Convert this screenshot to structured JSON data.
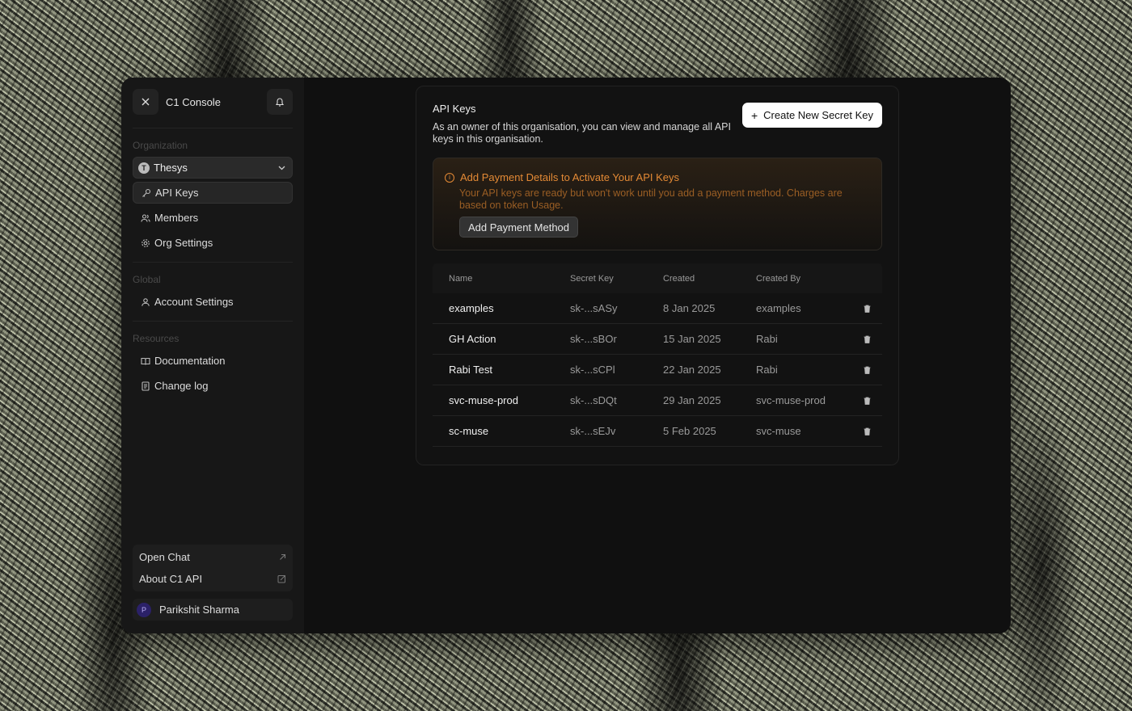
{
  "sidebar": {
    "app_title": "C1 Console",
    "org_label": "Organization",
    "org_name": "Thesys",
    "org_logo_letter": "T",
    "org_items": [
      {
        "label": "API Keys",
        "icon": "key-icon",
        "active": true
      },
      {
        "label": "Members",
        "icon": "users-icon"
      },
      {
        "label": "Org Settings",
        "icon": "gear-icon"
      }
    ],
    "global_label": "Global",
    "global_items": [
      {
        "label": "Account Settings",
        "icon": "user-icon"
      }
    ],
    "resources_label": "Resources",
    "resources_items": [
      {
        "label": "Documentation",
        "icon": "book-icon"
      },
      {
        "label": "Change log",
        "icon": "file-icon"
      }
    ],
    "links": [
      {
        "label": "Open Chat",
        "icon": "arrow-up-right-icon"
      },
      {
        "label": "About C1 API",
        "icon": "external-link-icon"
      }
    ],
    "user": {
      "initial": "P",
      "name": "Parikshit Sharma"
    }
  },
  "main": {
    "title": "API Keys",
    "description": "As an owner of this organisation, you can view and manage all API keys in this organisation.",
    "create_button": "Create New Secret Key",
    "alert": {
      "title": "Add Payment Details to Activate Your API Keys",
      "text": "Your API keys are ready but won't work until you add a payment method. Charges are based on token Usage.",
      "button": "Add Payment Method"
    },
    "table": {
      "columns": [
        "Name",
        "Secret Key",
        "Created",
        "Created By"
      ],
      "rows": [
        {
          "name": "examples",
          "key": "sk-...sASy",
          "created": "8 Jan 2025",
          "by": "examples"
        },
        {
          "name": "GH Action",
          "key": "sk-...sBOr",
          "created": "15 Jan 2025",
          "by": "Rabi"
        },
        {
          "name": "Rabi Test",
          "key": "sk-...sCPl",
          "created": "22 Jan 2025",
          "by": "Rabi"
        },
        {
          "name": "svc-muse-prod",
          "key": "sk-...sDQt",
          "created": "29 Jan 2025",
          "by": "svc-muse-prod"
        },
        {
          "name": "sc-muse",
          "key": "sk-...sEJv",
          "created": "5 Feb 2025",
          "by": "svc-muse"
        }
      ]
    }
  },
  "colors": {
    "accent_warning": "#e48a35",
    "primary_button": "#ffffff",
    "avatar": "#2b2168"
  }
}
